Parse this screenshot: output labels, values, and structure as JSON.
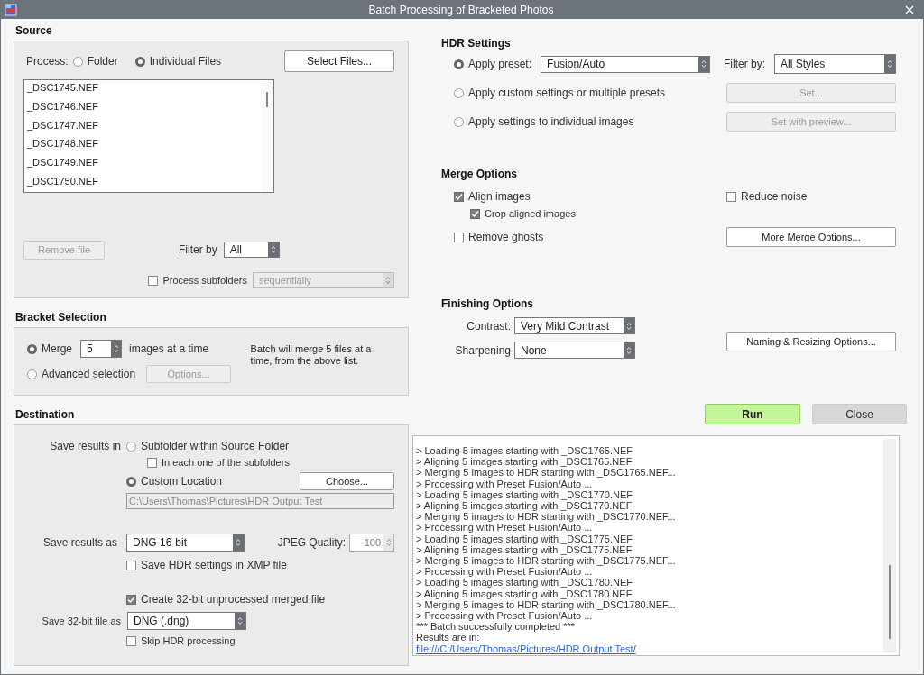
{
  "window": {
    "title": "Batch Processing of Bracketed Photos"
  },
  "source": {
    "heading": "Source",
    "process_label": "Process:",
    "process_options": [
      {
        "label": "Folder",
        "selected": false
      },
      {
        "label": "Individual Files",
        "selected": true
      }
    ],
    "select_button": "Select Files...",
    "files": [
      "_DSC1745.NEF",
      "_DSC1746.NEF",
      "_DSC1747.NEF",
      "_DSC1748.NEF",
      "_DSC1749.NEF",
      "_DSC1750.NEF"
    ],
    "remove_button": {
      "label": "Remove file",
      "disabled": true
    },
    "filter_label": "Filter by",
    "filter_value": "All",
    "subfolders": {
      "label": "Process subfolders",
      "checked": false
    },
    "subfolder_mode": {
      "value": "sequentially",
      "disabled": true
    }
  },
  "bracket": {
    "heading": "Bracket Selection",
    "merge": {
      "label": "Merge",
      "selected": true,
      "value": "5",
      "suffix": "images at a time"
    },
    "advanced": {
      "label": "Advanced selection",
      "selected": false,
      "button": "Options...",
      "button_disabled": true
    },
    "note": "Batch will merge 5 files at a time, from the above list."
  },
  "destination": {
    "heading": "Destination",
    "save_in_label": "Save results in",
    "locations": [
      {
        "label": "Subfolder within Source Folder",
        "selected": false
      },
      {
        "label": "Custom Location",
        "selected": true
      }
    ],
    "each_subfolder": {
      "label": "In each one of the subfolders",
      "checked": false
    },
    "choose_button": "Choose...",
    "path": "C:\\Users\\Thomas\\Pictures\\HDR Output Test",
    "save_as_label": "Save results as",
    "save_as_value": "DNG 16-bit",
    "jpeg_label": "JPEG Quality:",
    "jpeg_value": "100",
    "xmp": {
      "label": "Save HDR settings in XMP file",
      "checked": false
    },
    "create_32": {
      "label": "Create 32-bit unprocessed merged file",
      "checked": true
    },
    "save_32_label": "Save 32-bit file as",
    "save_32_value": "DNG (.dng)",
    "skip_hdr": {
      "label": "Skip HDR processing",
      "checked": false
    }
  },
  "hdr_settings": {
    "heading": "HDR Settings",
    "options": [
      {
        "label": "Apply preset:",
        "selected": true
      },
      {
        "label": "Apply custom settings or multiple presets",
        "selected": false
      },
      {
        "label": "Apply settings to individual images",
        "selected": false
      }
    ],
    "preset": "Fusion/Auto",
    "filter_label": "Filter by:",
    "filter_value": "All Styles",
    "buttons": [
      {
        "label": "Set...",
        "disabled": true
      },
      {
        "label": "Set with preview...",
        "disabled": true
      }
    ]
  },
  "merge_options": {
    "heading": "Merge Options",
    "align": {
      "label": "Align images",
      "checked": true,
      "children": [
        {
          "label": "Crop aligned images",
          "checked": true
        }
      ]
    },
    "reduce_noise": {
      "label": "Reduce noise",
      "checked": false
    },
    "remove_ghosts": {
      "label": "Remove ghosts",
      "checked": false
    },
    "more_button": "More Merge Options..."
  },
  "finishing": {
    "heading": "Finishing Options",
    "contrast_label": "Contrast:",
    "contrast_value": "Very Mild Contrast",
    "sharpening_label": "Sharpening",
    "sharpening_value": "None",
    "naming_button": "Naming & Resizing Options..."
  },
  "actions": [
    {
      "kind": "primary",
      "label": "Run"
    },
    {
      "kind": "secondary",
      "label": "Close"
    }
  ],
  "log": {
    "lines": [
      "> Loading 5 images starting with _DSC1765.NEF",
      "> Aligning 5 images starting with _DSC1765.NEF",
      "> Merging 5 images to HDR starting with _DSC1765.NEF...",
      "> Processing with Preset Fusion/Auto ...",
      "> Loading 5 images starting with _DSC1770.NEF",
      "> Aligning 5 images starting with _DSC1770.NEF",
      "> Merging 5 images to HDR starting with _DSC1770.NEF...",
      "> Processing with Preset Fusion/Auto ...",
      "> Loading 5 images starting with _DSC1775.NEF",
      "> Aligning 5 images starting with _DSC1775.NEF",
      "> Merging 5 images to HDR starting with _DSC1775.NEF...",
      "> Processing with Preset Fusion/Auto ...",
      "> Loading 5 images starting with _DSC1780.NEF",
      "> Aligning 5 images starting with _DSC1780.NEF",
      "> Merging 5 images to HDR starting with _DSC1780.NEF...",
      "> Processing with Preset Fusion/Auto ...",
      "*** Batch successfully completed ***",
      "Results are in:"
    ],
    "link": "file:///C:/Users/Thomas/Pictures/HDR Output Test/"
  }
}
